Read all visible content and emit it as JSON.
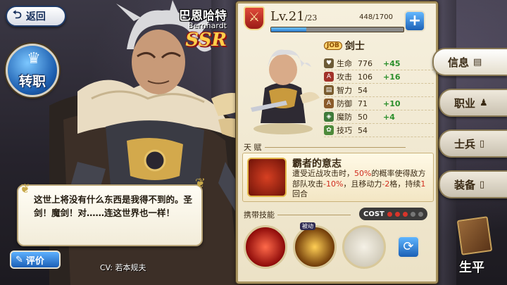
{
  "nav": {
    "back_label": "返回",
    "transfer_label": "转职"
  },
  "hero": {
    "name_cn": "巴恩哈特",
    "name_en": "Bernhardt",
    "rarity": "SSR",
    "quote": "这世上将没有什么东西是我得不到的。圣剑！魔剑！对……连这世界也一样！",
    "review_label": "评价",
    "cv": "CV:  若本规夫"
  },
  "panel": {
    "level_prefix": "Lv.",
    "level": "21",
    "level_max": "/23",
    "exp_text": "448/1700",
    "exp_fraction": 0.2635,
    "class_badge": "JOB",
    "class_name": "剑士",
    "stats": [
      {
        "icon": "heart-icon",
        "name": "生命",
        "value": "776",
        "bonus": "+45"
      },
      {
        "icon": "sword-icon",
        "name": "攻击",
        "value": "106",
        "bonus": "+16"
      },
      {
        "icon": "book-icon",
        "name": "智力",
        "value": "54",
        "bonus": ""
      },
      {
        "icon": "shield-icon",
        "name": "防御",
        "value": "71",
        "bonus": "+10"
      },
      {
        "icon": "magic-shield-icon",
        "name": "魔防",
        "value": "50",
        "bonus": "+4"
      },
      {
        "icon": "skill-icon",
        "name": "技巧",
        "value": "54",
        "bonus": ""
      }
    ],
    "talent_header": "天 赋",
    "talent_title": "霸者的意志",
    "talent_desc_1": "遭受近战攻击时，",
    "talent_desc_pct": "50%",
    "talent_desc_2": "的概率使得敌方部队攻击",
    "talent_desc_atk": "-10%",
    "talent_desc_3": "，且移动力",
    "talent_desc_move": "-2",
    "talent_desc_4": "格，持续",
    "talent_desc_turn": "1",
    "talent_desc_5": "回合",
    "skills_header": "携带技能",
    "cost_label": "COST",
    "cost_filled": 3,
    "cost_total": 5,
    "skill_tag": "被动"
  },
  "tabs": [
    {
      "label": "信息",
      "icon": "document-icon"
    },
    {
      "label": "职业",
      "icon": "person-icon"
    },
    {
      "label": "士兵",
      "icon": "phone-icon"
    },
    {
      "label": "装备",
      "icon": "phone-icon"
    }
  ],
  "life": {
    "label": "生平"
  },
  "colors": {
    "accent_blue": "#1d61b6",
    "bonus_green": "#2b8f2b",
    "highlight_red": "#d12d1d",
    "rarity_gold": "#ffd04a"
  }
}
